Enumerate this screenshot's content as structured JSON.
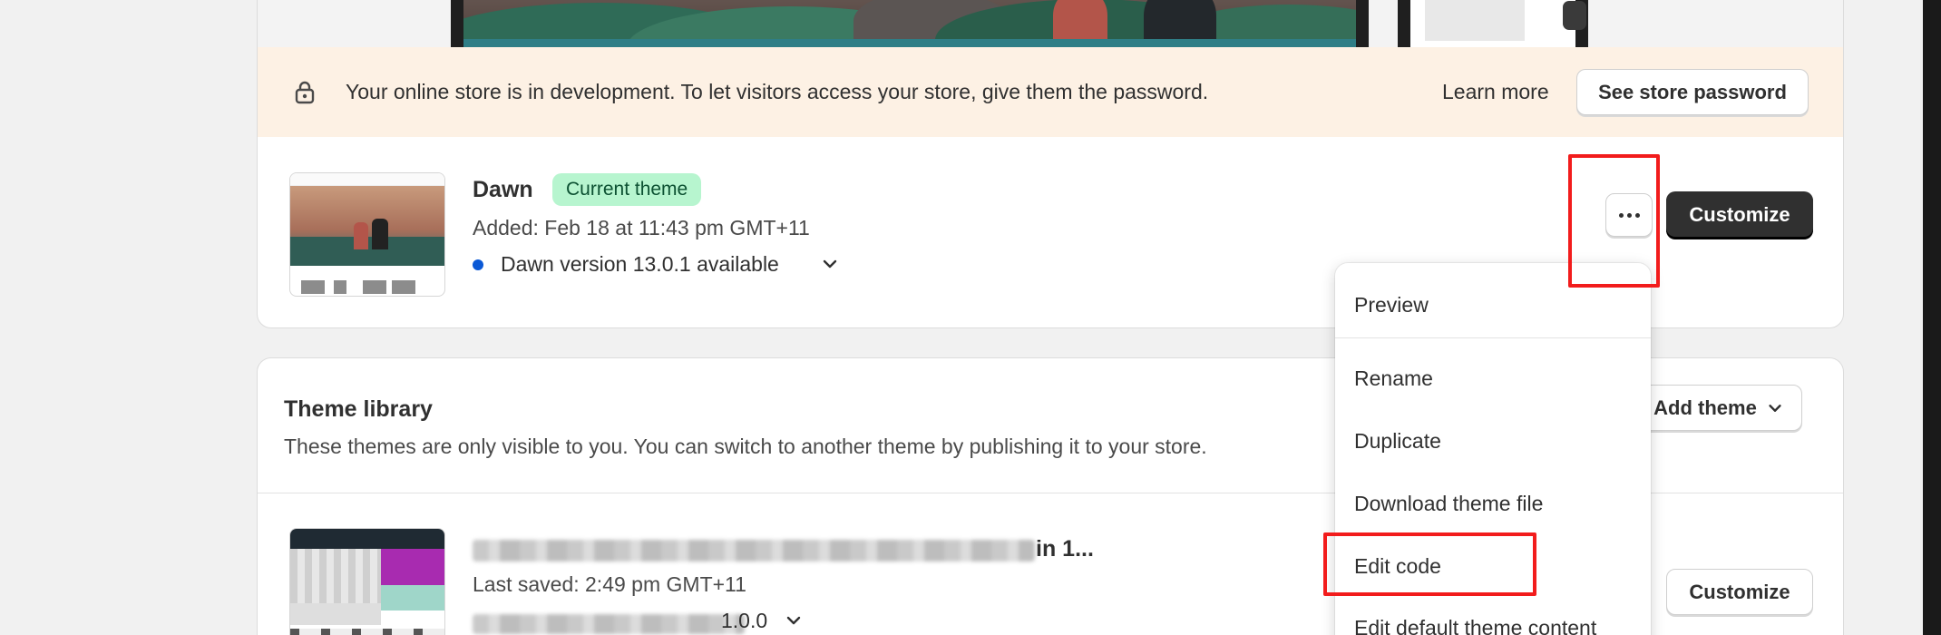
{
  "banner": {
    "message": "Your online store is in development. To let visitors access your store, give them the password.",
    "learn_more": "Learn more",
    "see_password": "See store password"
  },
  "current_theme": {
    "name": "Dawn",
    "badge": "Current theme",
    "added": "Added: Feb 18 at 11:43 pm GMT+11",
    "version_notice": "Dawn version 13.0.1 available",
    "customize_label": "Customize",
    "status_dot_color": "#0b59d6"
  },
  "theme_library": {
    "title": "Theme library",
    "description": "These themes are only visible to you. You can switch to another theme by publishing it to your store.",
    "add_theme_label": "Add theme",
    "items": [
      {
        "name_visible_suffix": "in 1...",
        "last_saved": "Last saved: 2:49 pm GMT+11",
        "version_visible_suffix": "1.0.0",
        "customize_label": "Customize"
      }
    ]
  },
  "menu": {
    "items": [
      {
        "label": "Preview"
      },
      {
        "label": "Rename"
      },
      {
        "label": "Duplicate"
      },
      {
        "label": "Download theme file"
      },
      {
        "label": "Edit code"
      },
      {
        "label": "Edit default theme content"
      }
    ]
  },
  "colors": {
    "banner_bg": "#fdf1e4",
    "badge_bg": "#b7f5cf",
    "badge_text": "#0c5132",
    "primary_button": "#303030",
    "highlight": "#f21c1c"
  }
}
